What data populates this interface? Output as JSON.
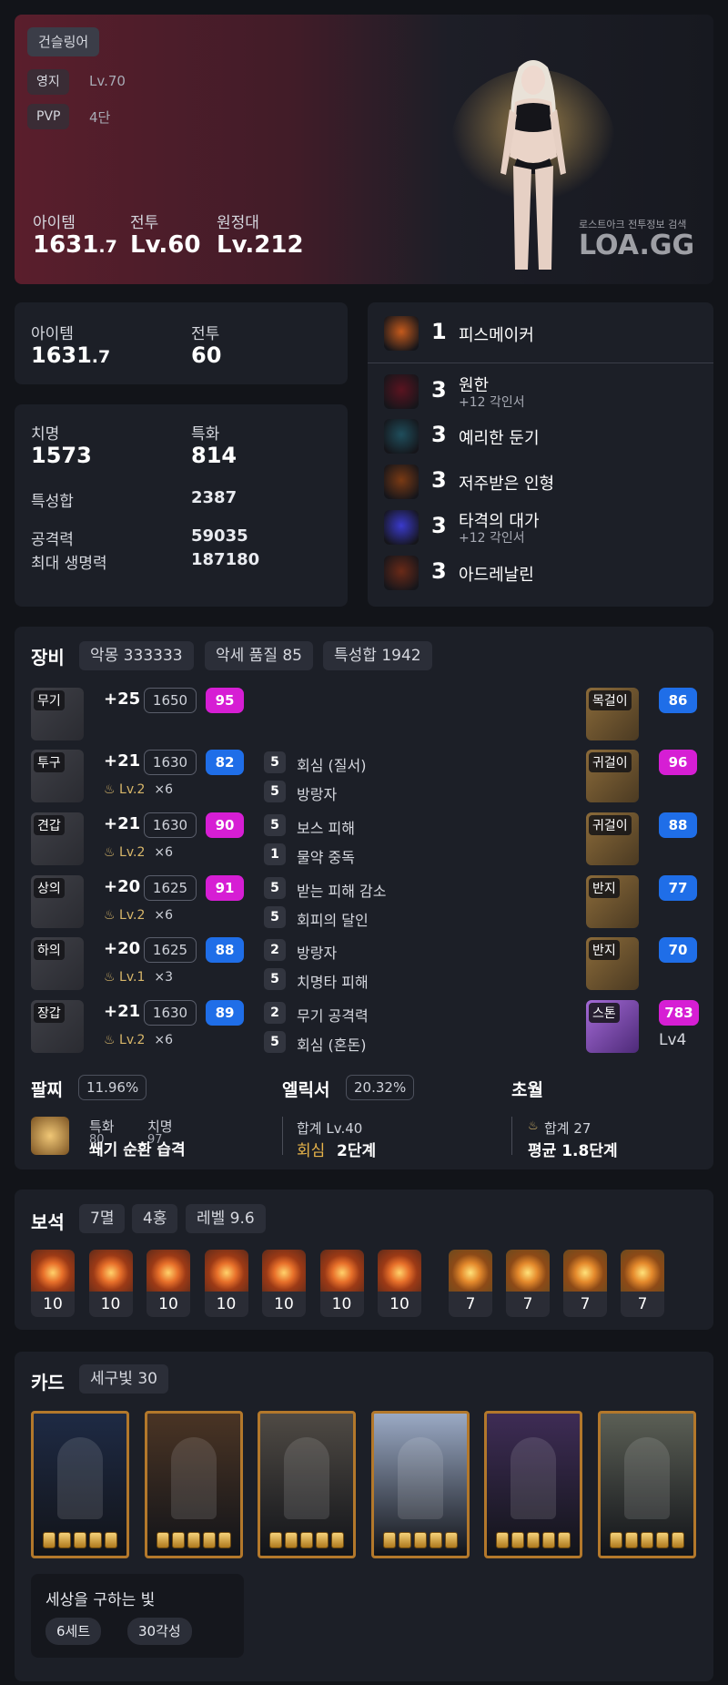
{
  "hero": {
    "class_name": "건슬링어",
    "estate_label": "영지",
    "estate_value": "Lv.70",
    "pvp_label": "PVP",
    "pvp_value": "4단",
    "item_label": "아이템",
    "item_int": "1631",
    "item_dec": ".7",
    "combat_label": "전투",
    "combat_value": "Lv.60",
    "expedition_label": "원정대",
    "expedition_value": "Lv.212",
    "watermark_small": "로스트아크 전투정보 검색",
    "watermark_logo": "LOA.GG"
  },
  "summary": {
    "item_label": "아이템",
    "item_int": "1631",
    "item_dec": ".7",
    "combat_label": "전투",
    "combat_value": "60"
  },
  "stats": {
    "crit_label": "치명",
    "crit_value": "1573",
    "spec_label": "특화",
    "spec_value": "814",
    "total_label": "특성합",
    "total_value": "2387",
    "atk_label": "공격력",
    "atk_value": "59035",
    "hp_label": "최대 생명력",
    "hp_value": "187180"
  },
  "engravings": [
    {
      "count": "1",
      "name": "피스메이커",
      "sub": "",
      "icon": "peacemaker-engraving-icon",
      "color": "#c45a1c"
    },
    {
      "count": "3",
      "name": "원한",
      "sub": "+12 각인서",
      "icon": "grudge-engraving-icon",
      "color": "#5a1420"
    },
    {
      "count": "3",
      "name": "예리한 둔기",
      "sub": "",
      "icon": "keen-blunt-weapon-engraving-icon",
      "color": "#1f4e5c"
    },
    {
      "count": "3",
      "name": "저주받은 인형",
      "sub": "",
      "icon": "cursed-doll-engraving-icon",
      "color": "#7a3a14"
    },
    {
      "count": "3",
      "name": "타격의 대가",
      "sub": "+12 각인서",
      "icon": "hit-master-engraving-icon",
      "color": "#3a3acc"
    },
    {
      "count": "3",
      "name": "아드레날린",
      "sub": "",
      "icon": "adrenaline-engraving-icon",
      "color": "#6a2a18"
    }
  ],
  "equipment": {
    "title": "장비",
    "chips": [
      "악몽 333333",
      "악세 품질 85",
      "특성합 1942"
    ],
    "gear": [
      {
        "slot": "무기",
        "upgrade": "+25",
        "ilvl": "1650",
        "quality": "95",
        "qcolor": "pink",
        "elixir": "",
        "mult": "",
        "opts": []
      },
      {
        "slot": "투구",
        "upgrade": "+21",
        "ilvl": "1630",
        "quality": "82",
        "qcolor": "blue",
        "elixir": "Lv.2",
        "mult": "×6",
        "opts": [
          {
            "n": "5",
            "t": "회심 (질서)"
          },
          {
            "n": "5",
            "t": "방랑자"
          }
        ]
      },
      {
        "slot": "견갑",
        "upgrade": "+21",
        "ilvl": "1630",
        "quality": "90",
        "qcolor": "pink",
        "elixir": "Lv.2",
        "mult": "×6",
        "opts": [
          {
            "n": "5",
            "t": "보스 피해"
          },
          {
            "n": "1",
            "t": "물약 중독"
          }
        ]
      },
      {
        "slot": "상의",
        "upgrade": "+20",
        "ilvl": "1625",
        "quality": "91",
        "qcolor": "pink",
        "elixir": "Lv.2",
        "mult": "×6",
        "opts": [
          {
            "n": "5",
            "t": "받는 피해 감소"
          },
          {
            "n": "5",
            "t": "회피의 달인"
          }
        ]
      },
      {
        "slot": "하의",
        "upgrade": "+20",
        "ilvl": "1625",
        "quality": "88",
        "qcolor": "blue",
        "elixir": "Lv.1",
        "mult": "×3",
        "opts": [
          {
            "n": "2",
            "t": "방랑자"
          },
          {
            "n": "5",
            "t": "치명타 피해"
          }
        ]
      },
      {
        "slot": "장갑",
        "upgrade": "+21",
        "ilvl": "1630",
        "quality": "89",
        "qcolor": "blue",
        "elixir": "Lv.2",
        "mult": "×6",
        "opts": [
          {
            "n": "2",
            "t": "무기 공격력"
          },
          {
            "n": "5",
            "t": "회심 (혼돈)"
          }
        ]
      }
    ],
    "accessories": [
      {
        "slot": "목걸이",
        "quality": "86",
        "qcolor": "blue"
      },
      {
        "slot": "귀걸이",
        "quality": "96",
        "qcolor": "pink"
      },
      {
        "slot": "귀걸이",
        "quality": "88",
        "qcolor": "blue"
      },
      {
        "slot": "반지",
        "quality": "77",
        "qcolor": "blue"
      },
      {
        "slot": "반지",
        "quality": "70",
        "qcolor": "blue"
      },
      {
        "slot": "스톤",
        "quality": "783",
        "qcolor": "pink",
        "extra": "Lv4"
      }
    ],
    "bracelet": {
      "label": "팔찌",
      "pct": "11.96%",
      "s1": "특화",
      "s1v": "80",
      "s2": "치명",
      "s2v": "97",
      "effects": "쐐기 순환 습격"
    },
    "elixir": {
      "label": "엘릭서",
      "pct": "20.32%",
      "total": "합계 Lv.40",
      "key": "회심",
      "stage": "2단계"
    },
    "transcend": {
      "label": "초월",
      "total": "합계 27",
      "avg": "평균 1.8단계"
    }
  },
  "gems": {
    "title": "보석",
    "chips": [
      "7멸",
      "4홍",
      "레벨 9.6"
    ],
    "levels": [
      "10",
      "10",
      "10",
      "10",
      "10",
      "10",
      "10",
      "7",
      "7",
      "7",
      "7"
    ]
  },
  "cards": {
    "title": "카드",
    "chip": "세구빛 30",
    "set_name": "세상을 구하는 빛",
    "set_tags": [
      "6세트",
      "30각성"
    ],
    "items": [
      {
        "name": "card-dark-knight",
        "awaken": 5,
        "bg": "#1e2a44"
      },
      {
        "name": "card-dwarf-warrior",
        "awaken": 5,
        "bg": "#4a3424"
      },
      {
        "name": "card-armored-knight",
        "awaken": 5,
        "bg": "#4f4a44"
      },
      {
        "name": "card-angel",
        "awaken": 5,
        "bg": "#9aa9c4"
      },
      {
        "name": "card-demon-pair",
        "awaken": 5,
        "bg": "#3e2c55"
      },
      {
        "name": "card-elf-mage",
        "awaken": 5,
        "bg": "#5b5f55"
      }
    ]
  }
}
